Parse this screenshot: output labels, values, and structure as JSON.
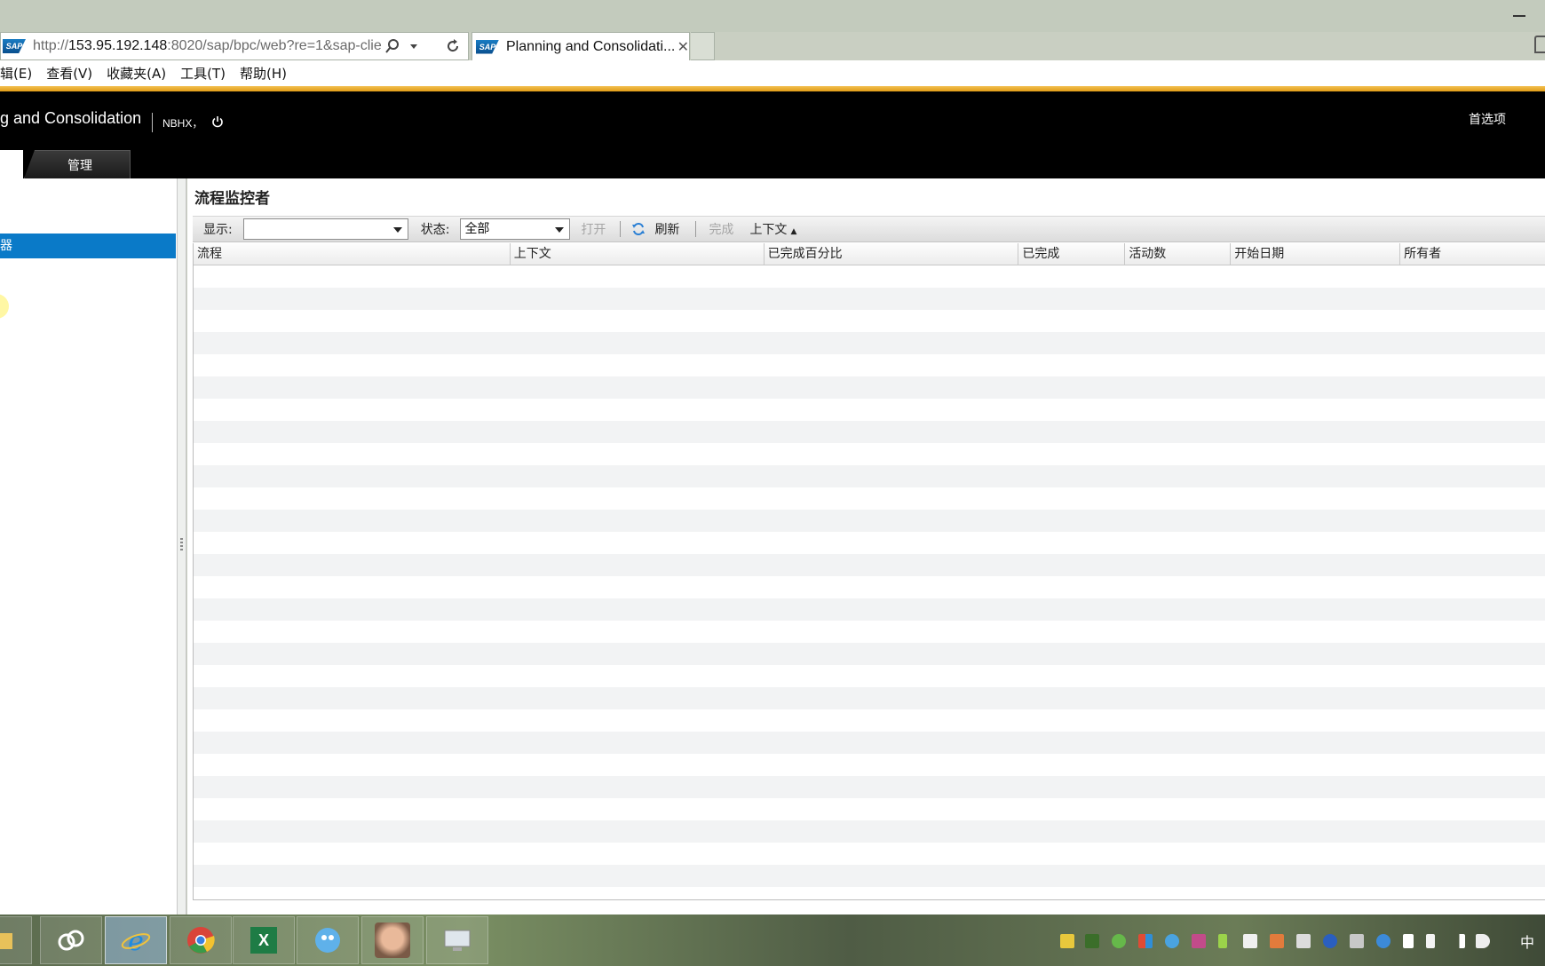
{
  "browser": {
    "url_prefix": "http://",
    "url_host": "153.95.192.148",
    "url_rest": ":8020/sap/bpc/web?re=1&sap-clie",
    "tab_label": "Planning and Consolidati...",
    "logo_text": "SAP"
  },
  "menubar": {
    "items": [
      "辑(E)",
      "查看(V)",
      "收藏夹(A)",
      "工具(T)",
      "帮助(H)"
    ]
  },
  "app": {
    "title": "g and Consolidation",
    "user": "NBHX，",
    "preferences": "首选项",
    "tabs": {
      "admin": "管理"
    }
  },
  "left_panel": {
    "selected_item": "器"
  },
  "main": {
    "page_title": "流程监控者",
    "toolbar": {
      "show_label": "显示:",
      "show_value": "",
      "status_label": "状态:",
      "status_value": "全部",
      "open": "打开",
      "refresh": "刷新",
      "complete": "完成",
      "context": "上下文",
      "context_arrow": "▲"
    },
    "columns": [
      "流程",
      "上下文",
      "已完成百分比",
      "已完成",
      "活动数",
      "开始日期",
      "所有者"
    ]
  },
  "taskbar": {
    "ime": "中",
    "excel_glyph": "X"
  },
  "colors": {
    "accent_gold": "#e09c16",
    "selection_blue": "#0a7ac8",
    "header_black": "#000000"
  }
}
